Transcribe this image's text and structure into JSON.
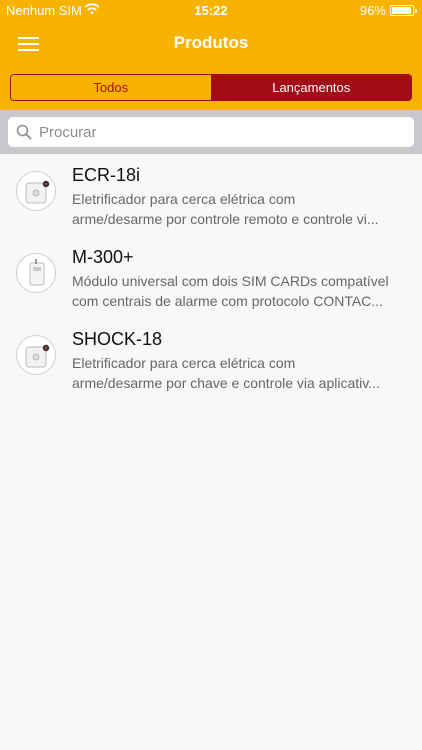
{
  "status_bar": {
    "carrier": "Nenhum SIM",
    "time": "15:22",
    "battery_percent": "96%",
    "battery_level": 0.96,
    "wifi_icon": "wifi-icon"
  },
  "nav": {
    "title": "Produtos",
    "menu_icon": "hamburger-menu-icon"
  },
  "segments": {
    "items": [
      "Todos",
      "Lançamentos"
    ],
    "selected": "Todos",
    "colors": {
      "accent": "#f7b300",
      "dark": "#a30d18"
    }
  },
  "search": {
    "placeholder": "Procurar",
    "icon": "search-icon"
  },
  "products": [
    {
      "name": "ECR-18i",
      "desc_line1": "Eletrificador para cerca elétrica com",
      "desc_line2": "arme/desarme por controle remoto e controle vi...",
      "thumb": "energizer-device-thumbnail"
    },
    {
      "name": "M-300+",
      "desc_line1": "Módulo universal com dois SIM CARDs compatível",
      "desc_line2": "com centrais de alarme com protocolo CONTAC...",
      "thumb": "module-device-thumbnail"
    },
    {
      "name": "SHOCK-18",
      "desc_line1": "Eletrificador para cerca elétrica com",
      "desc_line2": "arme/desarme por chave e controle via aplicativ...",
      "thumb": "energizer-device-thumbnail"
    }
  ]
}
